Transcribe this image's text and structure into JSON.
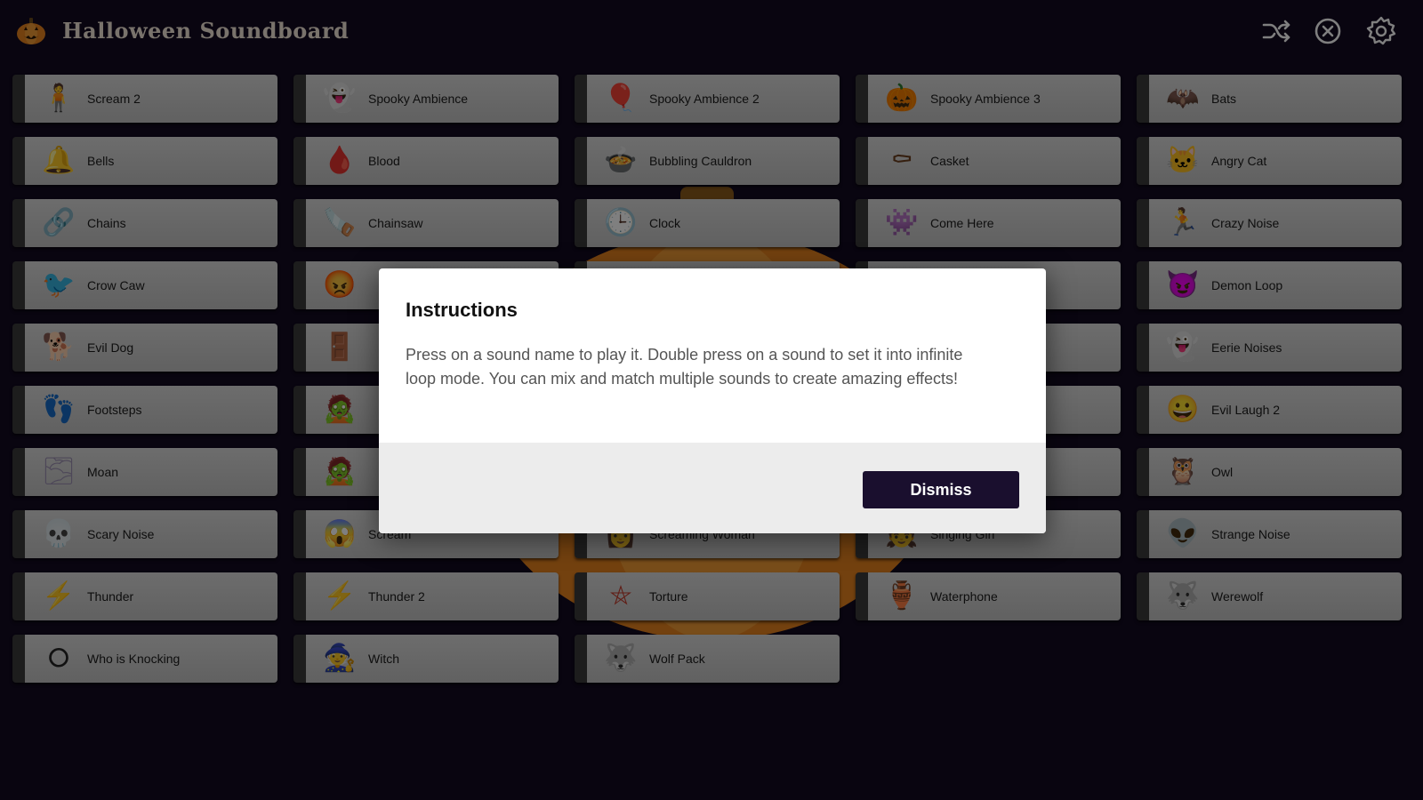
{
  "app": {
    "title": "Halloween Soundboard"
  },
  "header": {
    "shuffle_icon": "shuffle-icon",
    "stop_icon": "close-circle-icon",
    "settings_icon": "gear-icon"
  },
  "sounds": [
    {
      "label": "Scream 2",
      "icon": "🧍",
      "color": "#c0392b"
    },
    {
      "label": "Spooky Ambience",
      "icon": "👻",
      "color": "#2e4057"
    },
    {
      "label": "Spooky Ambience 2",
      "icon": "🎈",
      "color": "#c0392b"
    },
    {
      "label": "Spooky Ambience 3",
      "icon": "🎃",
      "color": "#e67e22"
    },
    {
      "label": "Bats",
      "icon": "🦇",
      "color": "#2c2c8a"
    },
    {
      "label": "Bells",
      "icon": "🔔",
      "color": "#d4a017"
    },
    {
      "label": "Blood",
      "icon": "🩸",
      "color": "#c0392b"
    },
    {
      "label": "Bubbling Cauldron",
      "icon": "🍲",
      "color": "#222"
    },
    {
      "label": "Casket",
      "icon": "⚰",
      "color": "#6b3e1f"
    },
    {
      "label": "Angry Cat",
      "icon": "🐱",
      "color": "#333"
    },
    {
      "label": "Chains",
      "icon": "🔗",
      "color": "#888"
    },
    {
      "label": "Chainsaw",
      "icon": "🪚",
      "color": "#b03a2e"
    },
    {
      "label": "Clock",
      "icon": "🕒",
      "color": "#4a6b5a"
    },
    {
      "label": "Come Here",
      "icon": "👾",
      "color": "#c0392b"
    },
    {
      "label": "Crazy Noise",
      "icon": "🏃",
      "color": "#e67e22"
    },
    {
      "label": "Crow Caw",
      "icon": "🐦",
      "color": "#1e2f4a"
    },
    {
      "label": "",
      "icon": "😡",
      "color": "#e31c1c"
    },
    {
      "label": "",
      "icon": "",
      "color": "#aaa"
    },
    {
      "label": "",
      "icon": "",
      "color": "#aaa"
    },
    {
      "label": "Demon Loop",
      "icon": "😈",
      "color": "#d35400"
    },
    {
      "label": "Evil Dog",
      "icon": "🐕",
      "color": "#4a3a2a"
    },
    {
      "label": "",
      "icon": "🚪",
      "color": "#8b4513"
    },
    {
      "label": "",
      "icon": "",
      "color": "#aaa"
    },
    {
      "label": "",
      "icon": "",
      "color": "#aaa"
    },
    {
      "label": "Eerie Noises",
      "icon": "👻",
      "color": "#999"
    },
    {
      "label": "Footsteps",
      "icon": "👣",
      "color": "#c0392b"
    },
    {
      "label": "",
      "icon": "🧟",
      "color": "#27ae60"
    },
    {
      "label": "",
      "icon": "",
      "color": "#aaa"
    },
    {
      "label": "",
      "icon": "",
      "color": "#aaa"
    },
    {
      "label": "Evil Laugh 2",
      "icon": "😀",
      "color": "#e5b800"
    },
    {
      "label": "Moan",
      "icon": "🌫",
      "color": "#9b8fb0"
    },
    {
      "label": "",
      "icon": "🧟",
      "color": "#777"
    },
    {
      "label": "",
      "icon": "",
      "color": "#aaa"
    },
    {
      "label": "",
      "icon": "",
      "color": "#aaa"
    },
    {
      "label": "Owl",
      "icon": "🦉",
      "color": "#5a3a1a"
    },
    {
      "label": "Scary Noise",
      "icon": "💀",
      "color": "#333"
    },
    {
      "label": "Scream",
      "icon": "😱",
      "color": "#8a6a5a"
    },
    {
      "label": "Screaming Woman",
      "icon": "👩",
      "color": "#ddd"
    },
    {
      "label": "Singing Girl",
      "icon": "👧",
      "color": "#333"
    },
    {
      "label": "Strange Noise",
      "icon": "👽",
      "color": "#27ae60"
    },
    {
      "label": "Thunder",
      "icon": "⚡",
      "color": "#ccc"
    },
    {
      "label": "Thunder 2",
      "icon": "⚡",
      "color": "#f1c40f"
    },
    {
      "label": "Torture",
      "icon": "⛤",
      "color": "#c0392b"
    },
    {
      "label": "Waterphone",
      "icon": "🏺",
      "color": "#9a8f7a"
    },
    {
      "label": "Werewolf",
      "icon": "🐺",
      "color": "#5a2a0a"
    },
    {
      "label": "Who is Knocking",
      "icon": "⭘",
      "color": "#222"
    },
    {
      "label": "Witch",
      "icon": "🧙",
      "color": "#6a3a8a"
    },
    {
      "label": "Wolf Pack",
      "icon": "🐺",
      "color": "#4a9a8a"
    }
  ],
  "dialog": {
    "title": "Instructions",
    "body": "Press on a sound name to play it. Double press on a sound to set it into infinite loop mode. You can mix and match multiple sounds to create amazing effects!",
    "dismiss_label": "Dismiss"
  },
  "colors": {
    "background": "#120a20",
    "accent": "#1a0f2e",
    "pumpkin": "#e6821e"
  }
}
